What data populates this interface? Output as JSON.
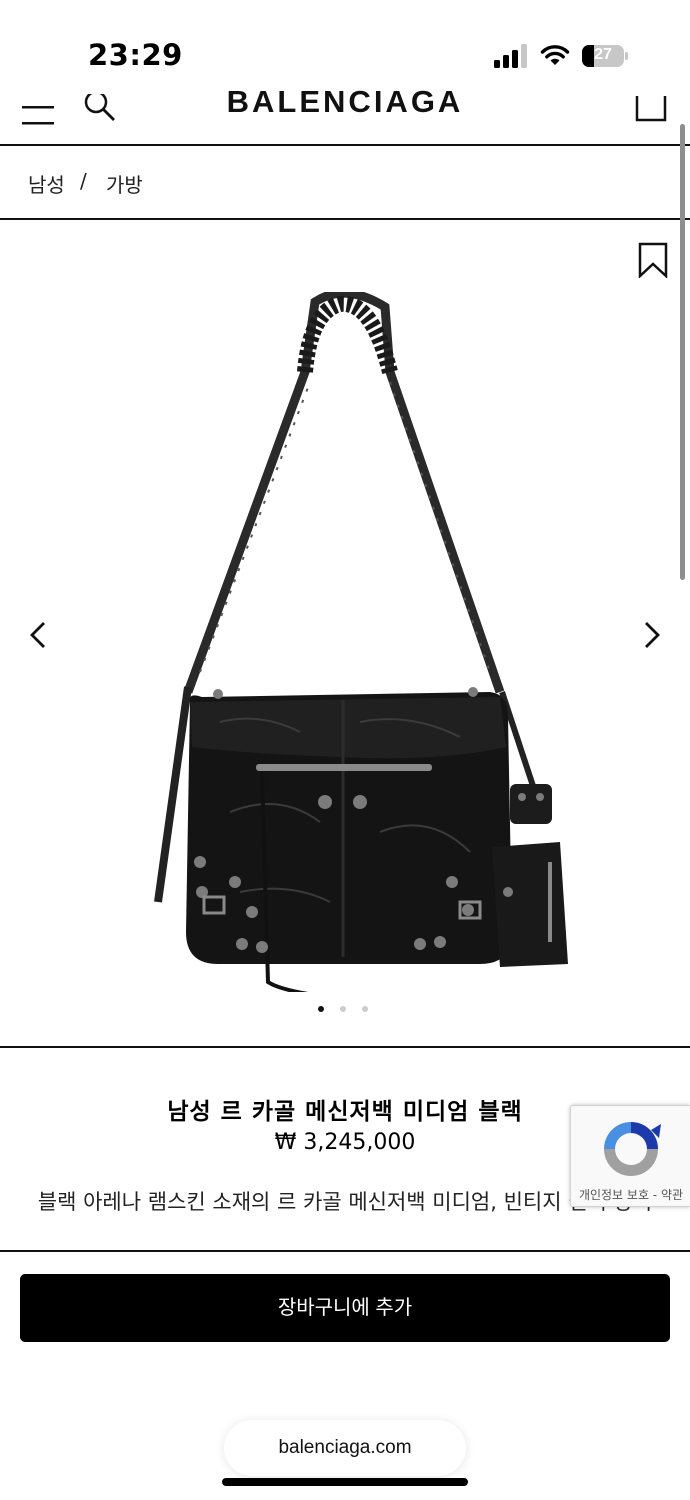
{
  "status_bar": {
    "time": "23:29",
    "battery": "27"
  },
  "header": {
    "brand": "BALENCIAGA"
  },
  "breadcrumb": {
    "items": [
      "남성",
      "가방"
    ],
    "separator": "/"
  },
  "gallery": {
    "slide_count": 3,
    "active_slide": 1
  },
  "product": {
    "name": "남성 르 카골 메신저백 미디엄 블랙",
    "price": "₩ 3,245,000",
    "description": "블랙 아레나 램스킨 소재의 르 카골 메신저백 미디엄, 빈티지 실버 장식"
  },
  "recaptcha": {
    "text": "개인정보 보호 - 약관"
  },
  "cart": {
    "add_label": "장바구니에 추가"
  },
  "browser": {
    "url": "balenciaga.com"
  }
}
